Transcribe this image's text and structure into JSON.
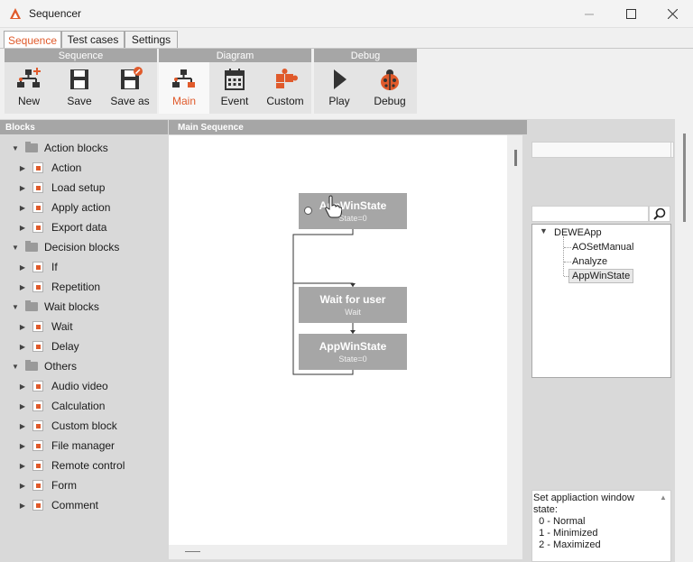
{
  "window": {
    "title": "Sequencer"
  },
  "tabs": [
    {
      "label": "Sequence",
      "active": true
    },
    {
      "label": "Test cases",
      "active": false
    },
    {
      "label": "Settings",
      "active": false
    }
  ],
  "ribbon": {
    "groups": [
      {
        "title": "Sequence",
        "buttons": [
          {
            "label": "New",
            "icon": "new-sequence-icon"
          },
          {
            "label": "Save",
            "icon": "save-icon"
          },
          {
            "label": "Save as",
            "icon": "save-as-icon"
          }
        ]
      },
      {
        "title": "Diagram",
        "buttons": [
          {
            "label": "Main",
            "icon": "diagram-main-icon",
            "active": true
          },
          {
            "label": "Event",
            "icon": "calendar-icon"
          },
          {
            "label": "Custom",
            "icon": "puzzle-icon"
          }
        ]
      },
      {
        "title": "Debug",
        "buttons": [
          {
            "label": "Play",
            "icon": "play-icon"
          },
          {
            "label": "Debug",
            "icon": "ladybug-icon"
          }
        ]
      }
    ]
  },
  "blocks_panel": {
    "title": "Blocks",
    "categories": [
      {
        "label": "Action blocks",
        "items": [
          "Action",
          "Load setup",
          "Apply action",
          "Export data"
        ]
      },
      {
        "label": "Decision blocks",
        "items": [
          "If",
          "Repetition"
        ]
      },
      {
        "label": "Wait blocks",
        "items": [
          "Wait",
          "Delay"
        ]
      },
      {
        "label": "Others",
        "items": [
          "Audio video",
          "Calculation",
          "Custom block",
          "File manager",
          "Remote control",
          "Form",
          "Comment"
        ]
      }
    ]
  },
  "diagram": {
    "title": "Main Sequence",
    "nodes": [
      {
        "title": "AppWinState",
        "subtitle": "State=0"
      },
      {
        "title": "Wait for user",
        "subtitle": "Wait"
      },
      {
        "title": "AppWinState",
        "subtitle": "State=0"
      }
    ]
  },
  "right_panel": {
    "field1_value": "",
    "search_placeholder": "",
    "tree": {
      "root": "DEWEApp",
      "children": [
        "AOSetManual",
        "Analyze",
        "AppWinState"
      ],
      "selected": "AppWinState"
    },
    "description": "Set appliaction window\nstate:\n  0 - Normal\n  1 - Minimized\n  2 - Maximized"
  },
  "colors": {
    "accent": "#e05a2b",
    "header_gray": "#a6a6a6",
    "panel_bg": "#d9d9d9"
  }
}
